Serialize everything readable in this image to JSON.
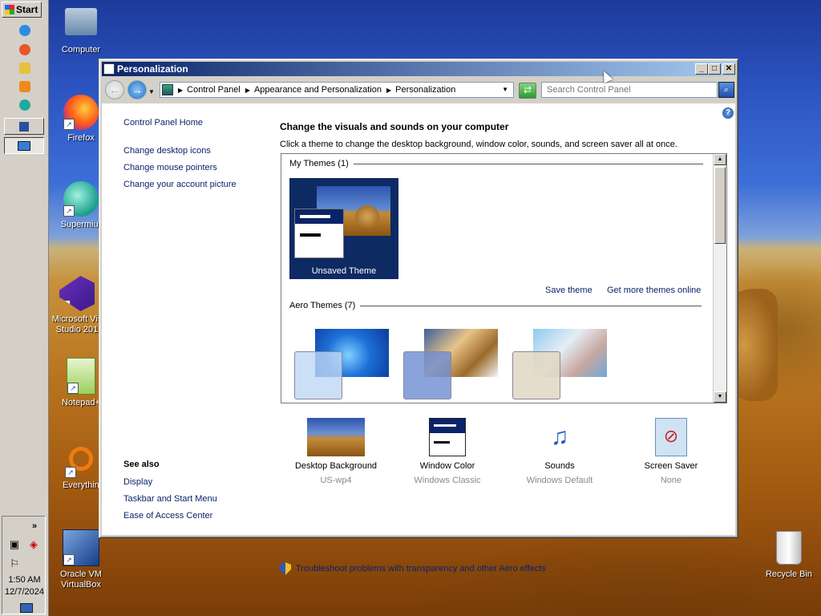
{
  "taskbar": {
    "start_label": "Start",
    "quick_launch": [
      {
        "name": "ie-icon",
        "color": "#2b8de0"
      },
      {
        "name": "firefox-icon",
        "color": "#e8562a"
      },
      {
        "name": "folder-icon",
        "color": "#e8c040"
      },
      {
        "name": "media-player-icon",
        "color": "#f08a1a"
      },
      {
        "name": "supermium-icon",
        "color": "#20a8a0"
      }
    ],
    "tray": {
      "time": "1:50 AM",
      "date": "12/7/2024"
    }
  },
  "desktop_icons": [
    {
      "label": "Computer",
      "icon": "computer-icon"
    },
    {
      "label": "Firefox",
      "icon": "firefox-icon"
    },
    {
      "label": "Supermiur",
      "icon": "supermium-icon"
    },
    {
      "label": "Microsoft Vis Studio 201",
      "icon": "visual-studio-icon"
    },
    {
      "label": "Notepad+",
      "icon": "notepad-plus-icon"
    },
    {
      "label": "Everythin",
      "icon": "everything-icon"
    },
    {
      "label": "Oracle VM VirtualBox",
      "icon": "virtualbox-icon"
    }
  ],
  "recycle_bin": {
    "label": "Recycle Bin"
  },
  "window": {
    "title": "Personalization",
    "address": {
      "crumbs": [
        "Control Panel",
        "Appearance and Personalization",
        "Personalization"
      ]
    },
    "search_placeholder": "Search Control Panel",
    "sidebar": {
      "home_link": "Control Panel Home",
      "links": [
        "Change desktop icons",
        "Change mouse pointers",
        "Change your account picture"
      ],
      "see_also_title": "See also",
      "see_also": [
        "Display",
        "Taskbar and Start Menu",
        "Ease of Access Center"
      ]
    },
    "main": {
      "title": "Change the visuals and sounds on your computer",
      "description": "Click a theme to change the desktop background, window color, sounds, and screen saver all at once.",
      "my_themes_header": "My Themes (1)",
      "unsaved_theme_label": "Unsaved Theme",
      "save_theme_link": "Save theme",
      "get_more_link": "Get more themes online",
      "aero_themes_header": "Aero Themes (7)"
    },
    "options": [
      {
        "name": "Desktop Background",
        "value": "US-wp4"
      },
      {
        "name": "Window Color",
        "value": "Windows Classic"
      },
      {
        "name": "Sounds",
        "value": "Windows Default"
      },
      {
        "name": "Screen Saver",
        "value": "None"
      }
    ],
    "troubleshoot_link": "Troubleshoot problems with transparency and other Aero effects"
  },
  "colors": {
    "link": "#0a246a",
    "title_bar_start": "#0a246a",
    "title_bar_end": "#a6caf0"
  }
}
